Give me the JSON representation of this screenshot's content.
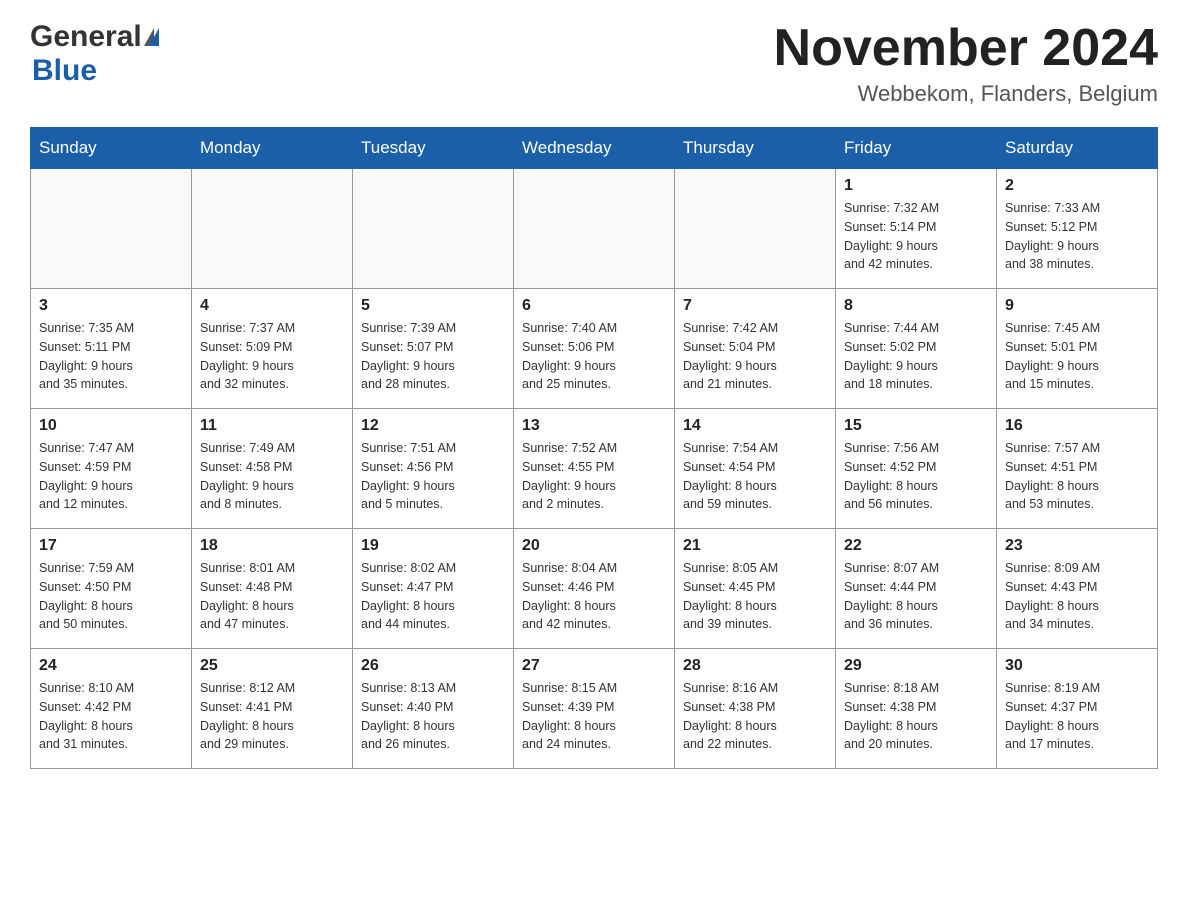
{
  "header": {
    "logo_general": "General",
    "logo_blue": "Blue",
    "month_title": "November 2024",
    "location": "Webbekom, Flanders, Belgium"
  },
  "days_of_week": [
    "Sunday",
    "Monday",
    "Tuesday",
    "Wednesday",
    "Thursday",
    "Friday",
    "Saturday"
  ],
  "weeks": [
    [
      {
        "day": "",
        "info": ""
      },
      {
        "day": "",
        "info": ""
      },
      {
        "day": "",
        "info": ""
      },
      {
        "day": "",
        "info": ""
      },
      {
        "day": "",
        "info": ""
      },
      {
        "day": "1",
        "info": "Sunrise: 7:32 AM\nSunset: 5:14 PM\nDaylight: 9 hours\nand 42 minutes."
      },
      {
        "day": "2",
        "info": "Sunrise: 7:33 AM\nSunset: 5:12 PM\nDaylight: 9 hours\nand 38 minutes."
      }
    ],
    [
      {
        "day": "3",
        "info": "Sunrise: 7:35 AM\nSunset: 5:11 PM\nDaylight: 9 hours\nand 35 minutes."
      },
      {
        "day": "4",
        "info": "Sunrise: 7:37 AM\nSunset: 5:09 PM\nDaylight: 9 hours\nand 32 minutes."
      },
      {
        "day": "5",
        "info": "Sunrise: 7:39 AM\nSunset: 5:07 PM\nDaylight: 9 hours\nand 28 minutes."
      },
      {
        "day": "6",
        "info": "Sunrise: 7:40 AM\nSunset: 5:06 PM\nDaylight: 9 hours\nand 25 minutes."
      },
      {
        "day": "7",
        "info": "Sunrise: 7:42 AM\nSunset: 5:04 PM\nDaylight: 9 hours\nand 21 minutes."
      },
      {
        "day": "8",
        "info": "Sunrise: 7:44 AM\nSunset: 5:02 PM\nDaylight: 9 hours\nand 18 minutes."
      },
      {
        "day": "9",
        "info": "Sunrise: 7:45 AM\nSunset: 5:01 PM\nDaylight: 9 hours\nand 15 minutes."
      }
    ],
    [
      {
        "day": "10",
        "info": "Sunrise: 7:47 AM\nSunset: 4:59 PM\nDaylight: 9 hours\nand 12 minutes."
      },
      {
        "day": "11",
        "info": "Sunrise: 7:49 AM\nSunset: 4:58 PM\nDaylight: 9 hours\nand 8 minutes."
      },
      {
        "day": "12",
        "info": "Sunrise: 7:51 AM\nSunset: 4:56 PM\nDaylight: 9 hours\nand 5 minutes."
      },
      {
        "day": "13",
        "info": "Sunrise: 7:52 AM\nSunset: 4:55 PM\nDaylight: 9 hours\nand 2 minutes."
      },
      {
        "day": "14",
        "info": "Sunrise: 7:54 AM\nSunset: 4:54 PM\nDaylight: 8 hours\nand 59 minutes."
      },
      {
        "day": "15",
        "info": "Sunrise: 7:56 AM\nSunset: 4:52 PM\nDaylight: 8 hours\nand 56 minutes."
      },
      {
        "day": "16",
        "info": "Sunrise: 7:57 AM\nSunset: 4:51 PM\nDaylight: 8 hours\nand 53 minutes."
      }
    ],
    [
      {
        "day": "17",
        "info": "Sunrise: 7:59 AM\nSunset: 4:50 PM\nDaylight: 8 hours\nand 50 minutes."
      },
      {
        "day": "18",
        "info": "Sunrise: 8:01 AM\nSunset: 4:48 PM\nDaylight: 8 hours\nand 47 minutes."
      },
      {
        "day": "19",
        "info": "Sunrise: 8:02 AM\nSunset: 4:47 PM\nDaylight: 8 hours\nand 44 minutes."
      },
      {
        "day": "20",
        "info": "Sunrise: 8:04 AM\nSunset: 4:46 PM\nDaylight: 8 hours\nand 42 minutes."
      },
      {
        "day": "21",
        "info": "Sunrise: 8:05 AM\nSunset: 4:45 PM\nDaylight: 8 hours\nand 39 minutes."
      },
      {
        "day": "22",
        "info": "Sunrise: 8:07 AM\nSunset: 4:44 PM\nDaylight: 8 hours\nand 36 minutes."
      },
      {
        "day": "23",
        "info": "Sunrise: 8:09 AM\nSunset: 4:43 PM\nDaylight: 8 hours\nand 34 minutes."
      }
    ],
    [
      {
        "day": "24",
        "info": "Sunrise: 8:10 AM\nSunset: 4:42 PM\nDaylight: 8 hours\nand 31 minutes."
      },
      {
        "day": "25",
        "info": "Sunrise: 8:12 AM\nSunset: 4:41 PM\nDaylight: 8 hours\nand 29 minutes."
      },
      {
        "day": "26",
        "info": "Sunrise: 8:13 AM\nSunset: 4:40 PM\nDaylight: 8 hours\nand 26 minutes."
      },
      {
        "day": "27",
        "info": "Sunrise: 8:15 AM\nSunset: 4:39 PM\nDaylight: 8 hours\nand 24 minutes."
      },
      {
        "day": "28",
        "info": "Sunrise: 8:16 AM\nSunset: 4:38 PM\nDaylight: 8 hours\nand 22 minutes."
      },
      {
        "day": "29",
        "info": "Sunrise: 8:18 AM\nSunset: 4:38 PM\nDaylight: 8 hours\nand 20 minutes."
      },
      {
        "day": "30",
        "info": "Sunrise: 8:19 AM\nSunset: 4:37 PM\nDaylight: 8 hours\nand 17 minutes."
      }
    ]
  ]
}
